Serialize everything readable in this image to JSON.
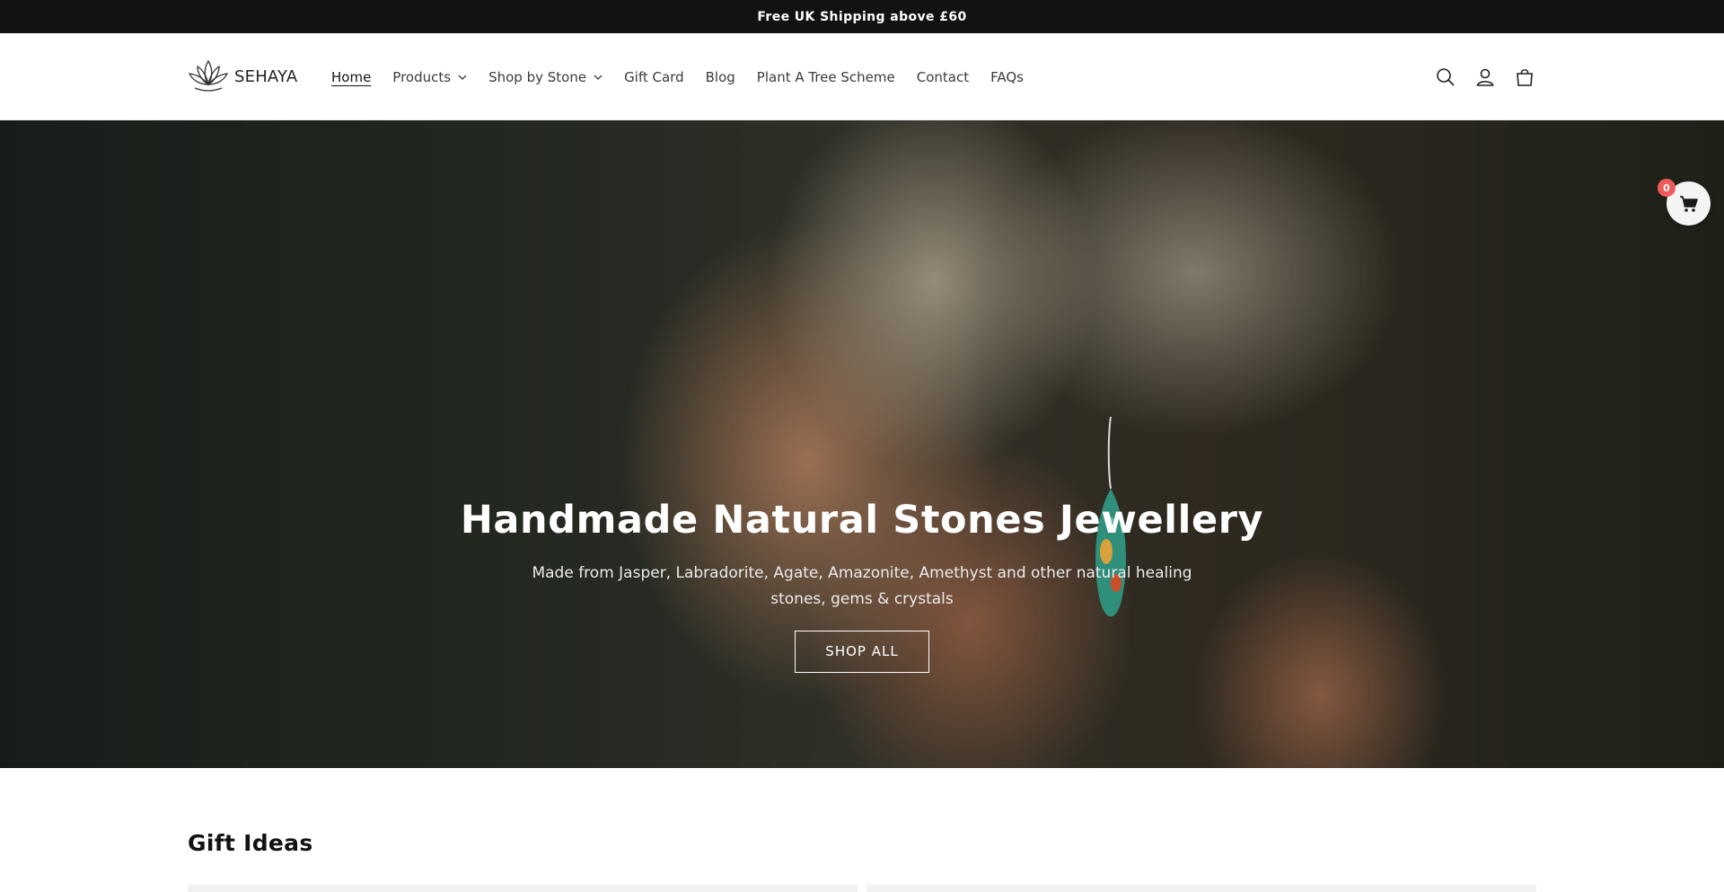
{
  "announcement": {
    "text": "Free UK Shipping above £60"
  },
  "brand": {
    "name": "SEHAYA"
  },
  "nav": {
    "items": [
      {
        "label": "Home",
        "active": true,
        "dropdown": false
      },
      {
        "label": "Products",
        "active": false,
        "dropdown": true
      },
      {
        "label": "Shop by Stone",
        "active": false,
        "dropdown": true
      },
      {
        "label": "Gift Card",
        "active": false,
        "dropdown": false
      },
      {
        "label": "Blog",
        "active": false,
        "dropdown": false
      },
      {
        "label": "Plant A Tree Scheme",
        "active": false,
        "dropdown": false
      },
      {
        "label": "Contact",
        "active": false,
        "dropdown": false
      },
      {
        "label": "FAQs",
        "active": false,
        "dropdown": false
      }
    ]
  },
  "header_icons": [
    "search-icon",
    "account-icon",
    "cart-icon"
  ],
  "hero": {
    "title": "Handmade Natural Stones Jewellery",
    "subtitle": "Made from Jasper, Labradorite, Agate, Amazonite, Amethyst and other natural healing stones, gems & crystals",
    "button_label": "SHOP ALL"
  },
  "floating_cart": {
    "count": "0"
  },
  "gift_ideas": {
    "title": "Gift Ideas"
  },
  "colors": {
    "announcement_bg": "#121212",
    "badge": "#ef5b5b",
    "text": "#121212"
  }
}
